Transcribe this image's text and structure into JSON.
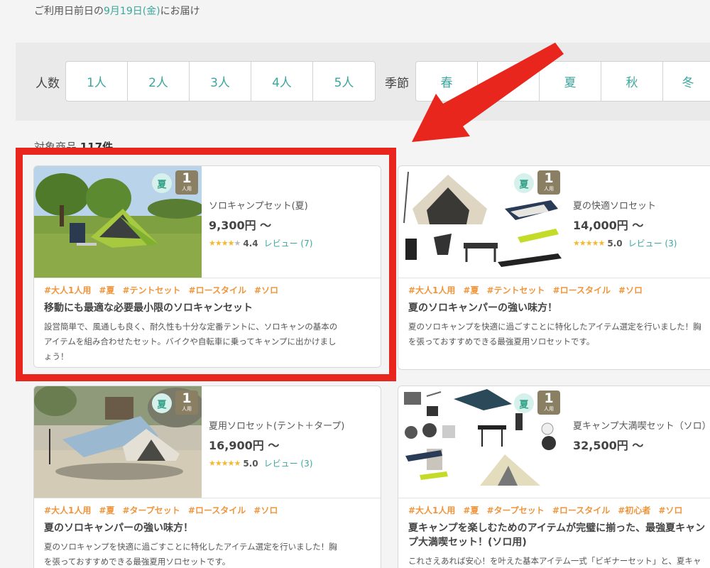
{
  "delivery": {
    "prefix": "ご利用日前日の",
    "date": "9月19日(金)",
    "suffix": "にお届け"
  },
  "filters": {
    "people_label": "人数",
    "people": [
      "1人",
      "2人",
      "3人",
      "4人",
      "5人"
    ],
    "season_label": "季節",
    "seasons": [
      "春",
      "夏",
      "夏",
      "秋",
      "冬"
    ]
  },
  "results": {
    "label": "対象商品",
    "count": "117件"
  },
  "products": [
    {
      "season": "夏",
      "people": "1",
      "people_unit": "人用",
      "name": "ソロキャンプセット(夏)",
      "price": "9,300円 〜",
      "stars_on": "★★★★",
      "stars_off": "★",
      "score": "4.4",
      "review": "レビュー (7)",
      "tags": [
        "#大人1人用",
        "#夏",
        "#テントセット",
        "#ロースタイル",
        "#ソロ"
      ],
      "headline": "移動にも最適な必要最小限のソロキャンセット",
      "desc": [
        "設営簡単で、風通しも良く、耐久性も十分な定番テントに、ソロキャンの基本の",
        "アイテムを組み合わせたセット。バイクや自転車に乗ってキャンプに出かけまし",
        "ょう！"
      ]
    },
    {
      "season": "夏",
      "people": "1",
      "people_unit": "人用",
      "name": "夏の快適ソロセット",
      "price": "14,000円 〜",
      "stars_on": "★★★★★",
      "stars_off": "",
      "score": "5.0",
      "review": "レビュー (3)",
      "tags": [
        "#大人1人用",
        "#夏",
        "#テントセット",
        "#ロースタイル",
        "#ソロ"
      ],
      "headline": "夏のソロキャンパーの強い味方！",
      "desc": [
        "夏のソロキャンプを快適に過ごすことに特化したアイテム選定を行いました！胸",
        "を張っておすすめできる最強夏用ソロセットです。"
      ]
    },
    {
      "season": "夏",
      "people": "1",
      "people_unit": "人用",
      "name": "夏用ソロセット(テント＋タープ)",
      "price": "16,900円 〜",
      "stars_on": "★★★★★",
      "stars_off": "",
      "score": "5.0",
      "review": "レビュー (3)",
      "tags": [
        "#大人1人用",
        "#夏",
        "#タープセット",
        "#ロースタイル",
        "#ソロ"
      ],
      "headline": "夏のソロキャンパーの強い味方！",
      "desc": [
        "夏のソロキャンプを快適に過ごすことに特化したアイテム選定を行いました！胸",
        "を張っておすすめできる最強夏用ソロセットです。"
      ]
    },
    {
      "season": "夏",
      "people": "1",
      "people_unit": "人用",
      "name": "夏キャンプ大満喫セット（ソロ）",
      "price": "32,500円 〜",
      "stars_on": "",
      "stars_off": "",
      "score": "",
      "review": "",
      "tags": [
        "#大人1人用",
        "#夏",
        "#タープセット",
        "#ロースタイル",
        "#初心者",
        "#ソロ"
      ],
      "headline": "夏キャンプを楽しむためのアイテムが完璧に揃った、最強夏キャン",
      "headline2": "プ大満喫セット！(ソロ用)",
      "desc": [
        "これさえあれば安心！を叶えた基本アイテム一式「ビギナーセット」と、夏キャ"
      ]
    }
  ]
}
